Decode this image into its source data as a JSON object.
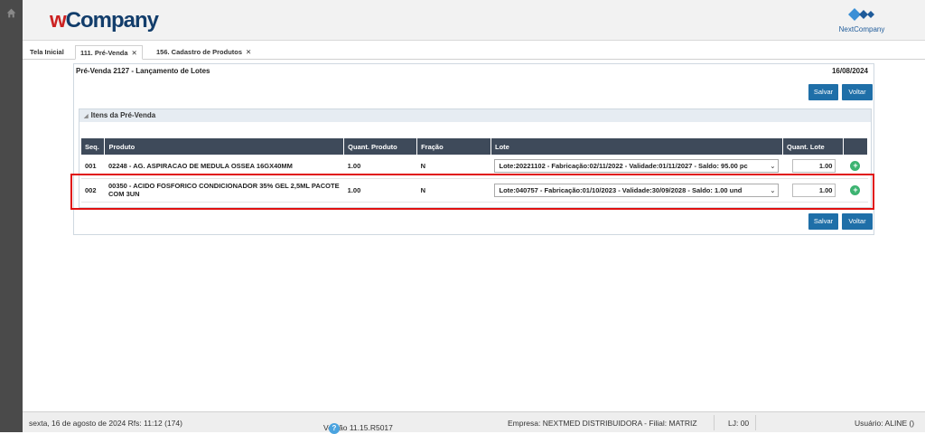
{
  "app": {
    "logo_prefix": "w",
    "logo_main": "Company",
    "partner_logo": "NextCompany"
  },
  "tabs": [
    {
      "label": "Tela Inicial",
      "closable": false
    },
    {
      "label": "111. Pré-Venda",
      "closable": true,
      "active": true
    },
    {
      "label": "156. Cadastro de Produtos",
      "closable": true
    }
  ],
  "tab_close_glyph": "✕",
  "panel": {
    "title": "Pré-Venda 2127 - Lançamento de Lotes",
    "date": "16/08/2024",
    "save_label": "Salvar",
    "back_label": "Voltar"
  },
  "section": {
    "title": "Itens da Pré-Venda"
  },
  "table": {
    "headers": [
      "Seq.",
      "Produto",
      "Quant. Produto",
      "Fração",
      "Lote",
      "Quant. Lote",
      ""
    ],
    "rows": [
      {
        "seq": "001",
        "produto": "02248 - AG. ASPIRACAO DE MEDULA OSSEA 16GX40MM",
        "quant_produto": "1.00",
        "fracao": "N",
        "lote": "Lote:20221102 - Fabricação:02/11/2022 - Validade:01/11/2027 - Saldo: 95.00 pc",
        "quant_lote": "1.00"
      },
      {
        "seq": "002",
        "produto": "00350 - ACIDO FOSFORICO CONDICIONADOR 35% GEL 2,5ML PACOTE COM 3UN",
        "quant_produto": "1.00",
        "fracao": "N",
        "lote": "Lote:040757 - Fabricação:01/10/2023 - Validade:30/09/2028 - Saldo: 1.00 und",
        "quant_lote": "1.00"
      }
    ]
  },
  "status": {
    "datetime": "sexta, 16 de agosto de 2024  Rfs: 11:12 (174)",
    "version": "Versão 11.15.R5017",
    "company": "Empresa: NEXTMED DISTRIBUIDORA - Filial: MATRIZ",
    "lj": "LJ: 00",
    "user": "Usuário: ALINE ()"
  },
  "colors": {
    "primary_button": "#1f6fa8",
    "table_header": "#3e4a5a",
    "highlight": "#e01010",
    "add_button": "#3cb371"
  }
}
